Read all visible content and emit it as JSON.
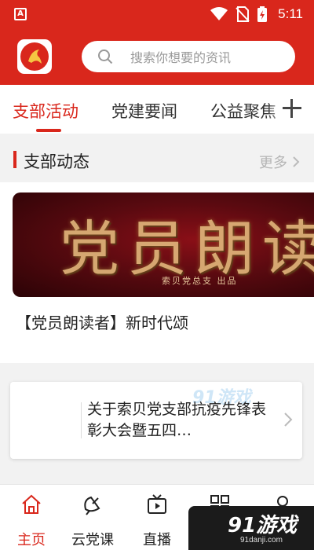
{
  "status_bar": {
    "notification_letter": "A",
    "time": "5:11",
    "icons": [
      "wifi-icon",
      "no-sim-icon",
      "battery-icon"
    ]
  },
  "header": {
    "logo": "party-emblem-logo",
    "search": {
      "placeholder": "搜索你想要的资讯"
    }
  },
  "tabs": {
    "items": [
      "支部活动",
      "党建要闻",
      "公益聚焦"
    ],
    "active_index": 0,
    "add_icon": "plus-icon"
  },
  "section": {
    "title": "支部动态",
    "more_label": "更多"
  },
  "feature": {
    "banner_art_text": "党员朗读",
    "banner_credit": "索贝党总支 出品",
    "caption": "【党员朗读者】新时代颂"
  },
  "notice": {
    "text": "关于索贝党支部抗疫先锋表彰大会暨五四…",
    "watermark": "91游戏"
  },
  "bottom_nav": {
    "items": [
      {
        "label": "主页",
        "icon": "home-icon",
        "active": true
      },
      {
        "label": "云党课",
        "icon": "satellite-dish-icon",
        "active": false
      },
      {
        "label": "直播",
        "icon": "tv-icon",
        "active": false
      },
      {
        "label": "",
        "icon": "grid-icon",
        "active": false
      },
      {
        "label": "",
        "icon": "profile-icon",
        "active": false
      }
    ]
  },
  "watermark": {
    "big": "91游戏",
    "small": "91danji.com"
  },
  "colors": {
    "brand_red": "#d9271c",
    "muted_gray": "#9a9a9a"
  }
}
